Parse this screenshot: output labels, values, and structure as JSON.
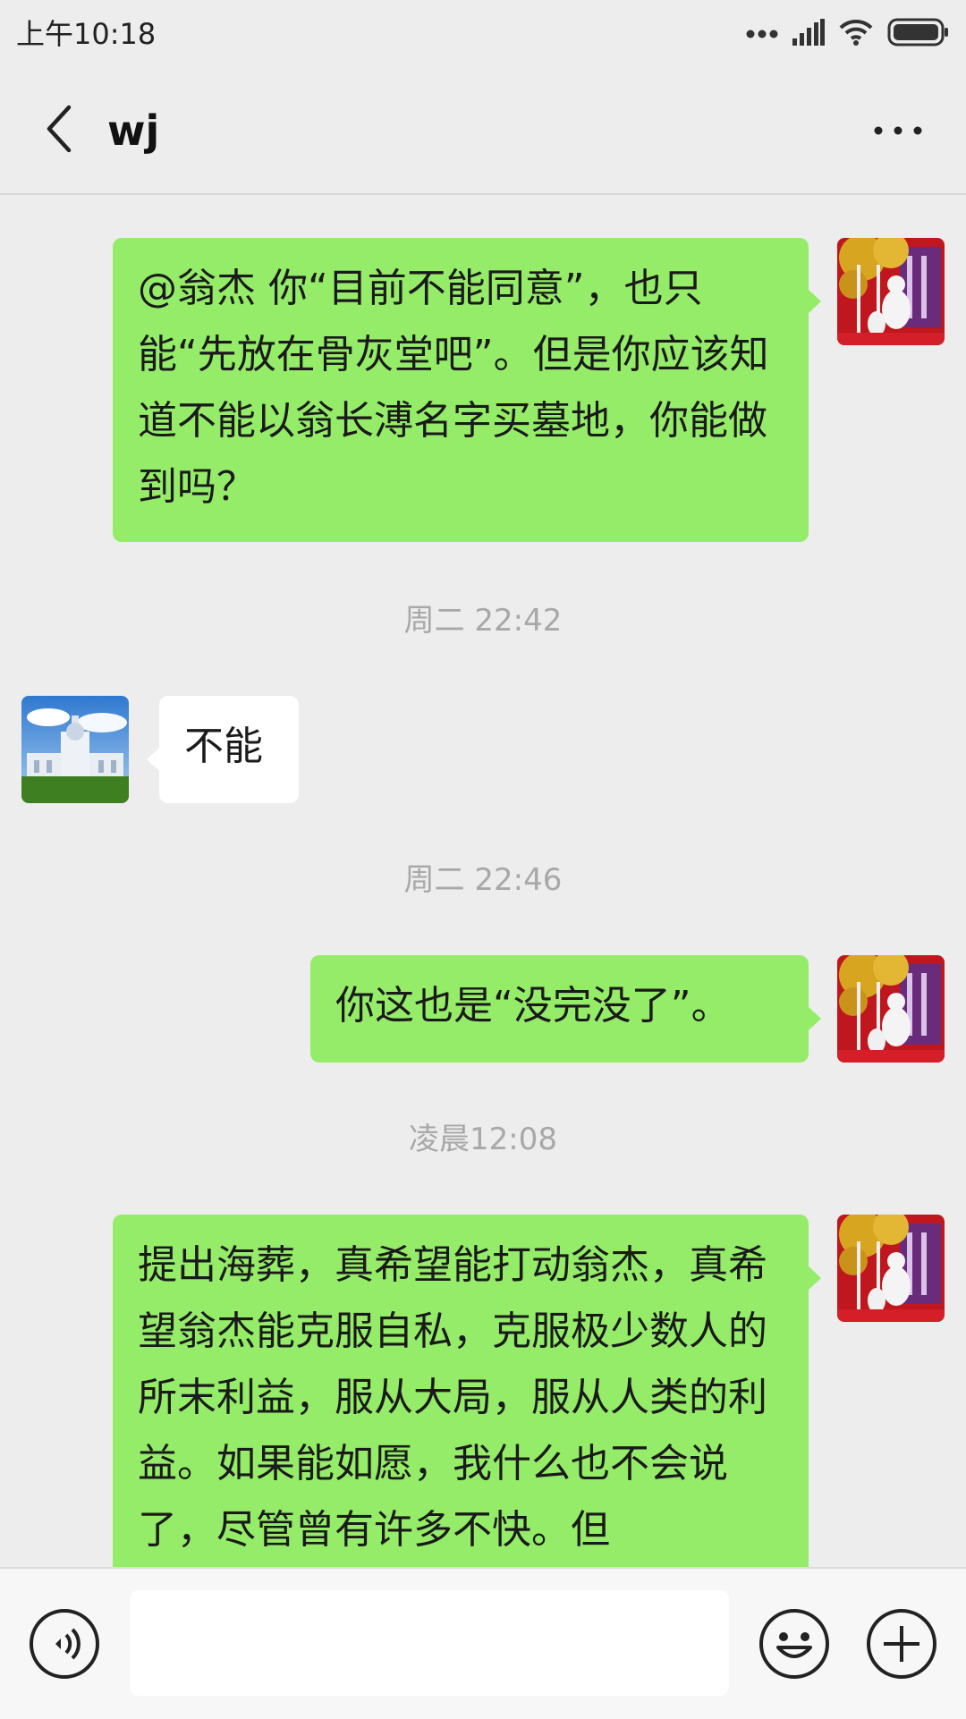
{
  "status_bar": {
    "time": "上午10:18",
    "icons": [
      "more-dots-icon",
      "signal-icon",
      "wifi-icon",
      "battery-icon"
    ]
  },
  "header": {
    "title": "wj",
    "back_icon": "chevron-left-icon",
    "more_icon": "more-horizontal-icon"
  },
  "messages": [
    {
      "direction": "outgoing",
      "text": "@翁杰  你“目前不能同意”，也只能“先放在骨灰堂吧”。但是你应该知道不能以翁长溥名字买墓地，你能做到吗？"
    },
    {
      "timestamp": "周二 22:42"
    },
    {
      "direction": "incoming",
      "text": "不能"
    },
    {
      "timestamp": "周二 22:46"
    },
    {
      "direction": "outgoing",
      "text": "你这也是“没完没了”。"
    },
    {
      "timestamp": "凌晨12:08"
    },
    {
      "direction": "outgoing",
      "text": "提出海葬，真希望能打动翁杰，真希望翁杰能克服自私，克服极少数人的所末利益，服从大局，服从人类的利益。如果能如愿，我什么也不会说了，尽管曾有许多不快。但"
    }
  ],
  "input_bar": {
    "voice_icon": "voice-icon",
    "input_value": "",
    "emoji_icon": "emoji-icon",
    "plus_icon": "plus-circle-icon"
  },
  "colors": {
    "background": "#ededed",
    "outgoing_bubble": "#95ec69",
    "incoming_bubble": "#ffffff",
    "timestamp_text": "#a8a8a8"
  }
}
